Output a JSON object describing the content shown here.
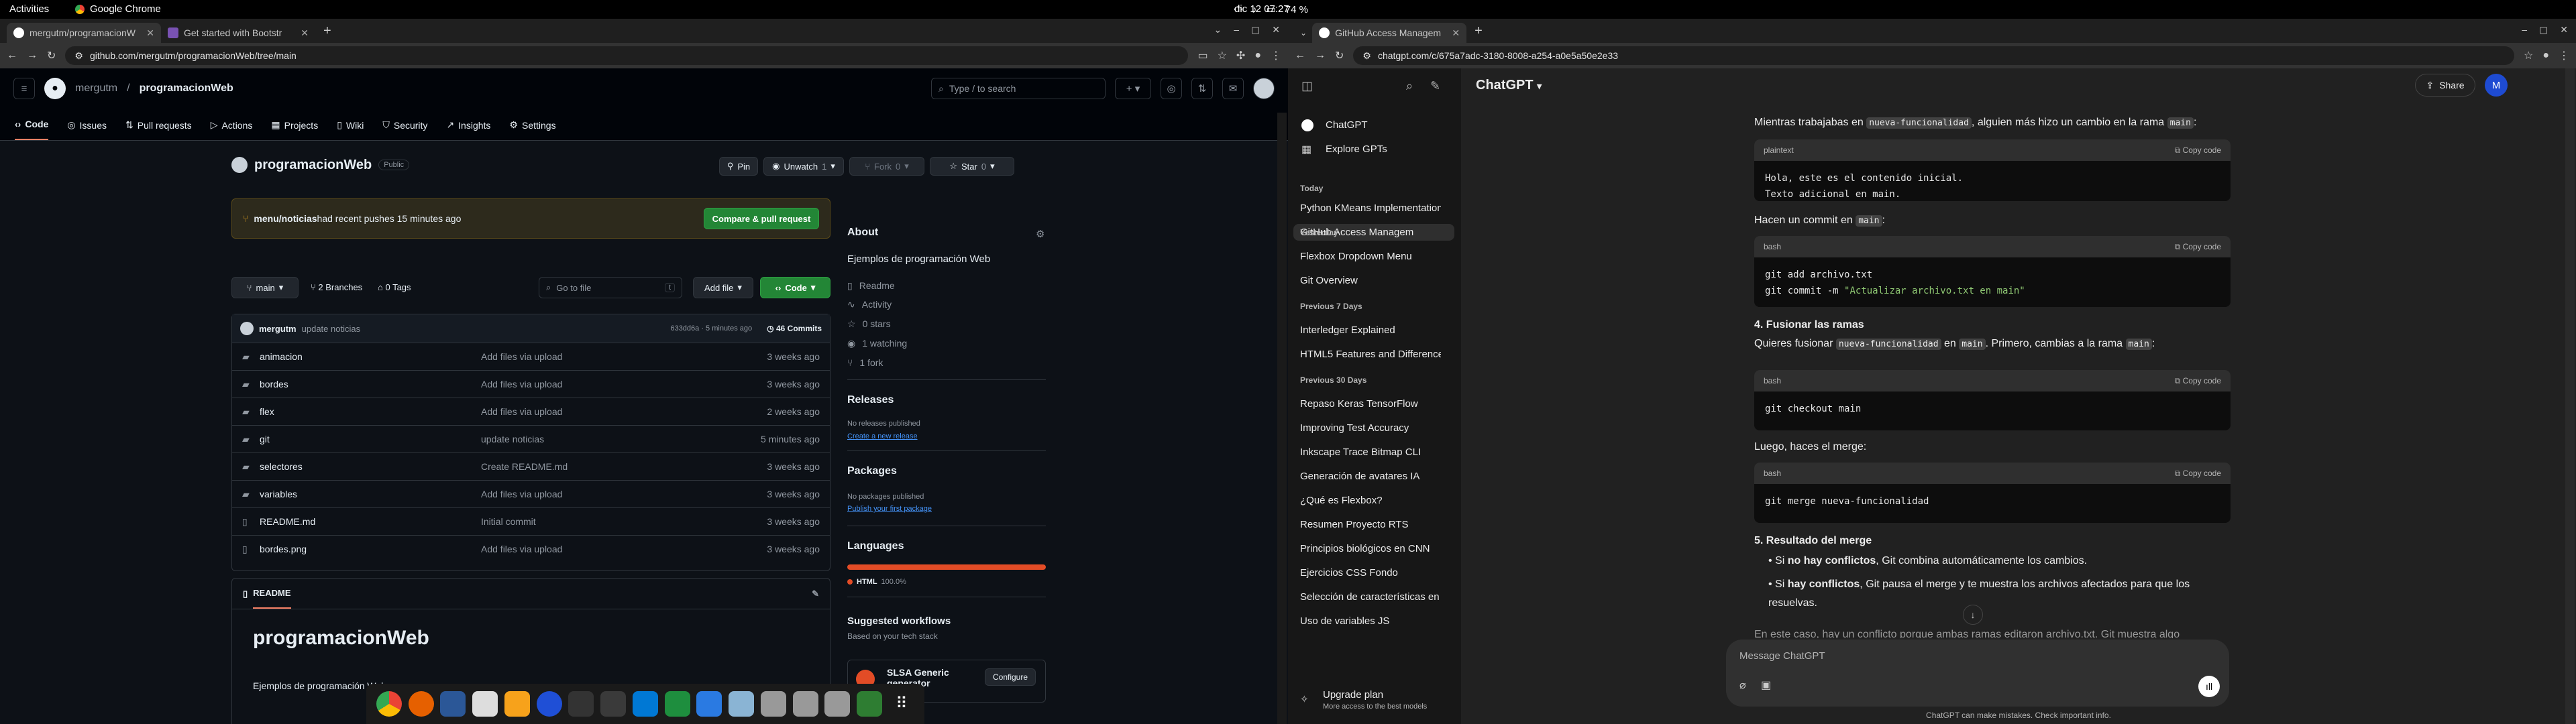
{
  "system": {
    "activities": "Activities",
    "app": "Google Chrome",
    "clock": "dic 12  07:27",
    "battery": "74 %"
  },
  "left": {
    "tabs": [
      {
        "label": "mergutm/programacionW"
      },
      {
        "label": "Get started with Bootstr"
      }
    ],
    "url": "github.com/mergutm/programacionWeb/tree/main",
    "gh": {
      "owner": "mergutm",
      "sep": "/",
      "repo": "programacionWeb",
      "search": "Type / to search",
      "nav": [
        "Code",
        "Issues",
        "Pull requests",
        "Actions",
        "Projects",
        "Wiki",
        "Security",
        "Insights",
        "Settings"
      ],
      "repo_title": "programacionWeb",
      "visibility": "Public",
      "pin": "Pin",
      "unwatch": "Unwatch",
      "unwatch_count": "1",
      "fork": "Fork",
      "fork_count": "0",
      "star": "Star",
      "star_count": "0",
      "banner_branch": "menu/noticias",
      "banner_text": " had recent pushes 15 minutes ago",
      "compare": "Compare & pull request",
      "branch": "main",
      "branches": "2 Branches",
      "tags": "0 Tags",
      "goto": "Go to file",
      "goto_key": "t",
      "addfile": "Add file",
      "codebtn": "Code",
      "commit_user": "mergutm",
      "commit_msg": "update noticias",
      "commit_meta": "633dd6a · 5 minutes ago",
      "commits": "46 Commits",
      "files": [
        {
          "icon": "folder-icon",
          "name": "animacion",
          "msg": "Add files via upload",
          "time": "3 weeks ago"
        },
        {
          "icon": "folder-icon",
          "name": "bordes",
          "msg": "Add files via upload",
          "time": "3 weeks ago"
        },
        {
          "icon": "folder-icon",
          "name": "flex",
          "msg": "Add files via upload",
          "time": "2 weeks ago"
        },
        {
          "icon": "folder-icon",
          "name": "git",
          "msg": "update noticias",
          "time": "5 minutes ago"
        },
        {
          "icon": "folder-icon",
          "name": "selectores",
          "msg": "Create README.md",
          "time": "3 weeks ago"
        },
        {
          "icon": "folder-icon",
          "name": "variables",
          "msg": "Add files via upload",
          "time": "3 weeks ago"
        },
        {
          "icon": "file-icon",
          "name": "README.md",
          "msg": "Initial commit",
          "time": "3 weeks ago"
        },
        {
          "icon": "file-icon",
          "name": "bordes.png",
          "msg": "Add files via upload",
          "time": "3 weeks ago"
        }
      ],
      "readme_tab": "README",
      "readme_h1": "programacionWeb",
      "readme_p": "Ejemplos de programación Web",
      "about": {
        "title": "About",
        "desc": "Ejemplos de programación Web",
        "readme": "Readme",
        "activity": "Activity",
        "stars": "0 stars",
        "watching": "1 watching",
        "fork": "1 fork"
      },
      "releases": {
        "title": "Releases",
        "none": "No releases published",
        "create": "Create a new release"
      },
      "packages": {
        "title": "Packages",
        "none": "No packages published",
        "publish": "Publish your first package"
      },
      "languages": {
        "title": "Languages",
        "html": "HTML",
        "pct": "100.0%",
        "color": "#e34c26"
      },
      "workflows": {
        "title": "Suggested workflows",
        "sub": "Based on your tech stack",
        "name": "SLSA Generic generator",
        "configure": "Configure"
      }
    }
  },
  "right": {
    "tab": "GitHub Access Managem",
    "url": "chatgpt.com/c/675a7adc-3180-8008-a254-a0e5a50e2e33",
    "sidebar": {
      "chatgpt": "ChatGPT",
      "explore": "Explore GPTs",
      "today": "Today",
      "today_items": [
        "Python KMeans Implementation",
        "GitHub Access Managem"
      ],
      "yesterday": "Yesterday",
      "yest_items": [
        "Flexbox Dropdown Menu",
        "Git Overview"
      ],
      "prev7": "Previous 7 Days",
      "prev7_items": [
        "Interledger Explained",
        "HTML5 Features and Difference"
      ],
      "prev30": "Previous 30 Days",
      "prev30_items": [
        "Repaso Keras TensorFlow",
        "Improving Test Accuracy",
        "Inkscape Trace Bitmap CLI",
        "Generación de avatares IA",
        "¿Qué es Flexbox?",
        "Resumen Proyecto RTS",
        "Principios biológicos en CNN",
        "Ejercicios CSS Fondo",
        "Selección de características en",
        "Uso de variables JS"
      ],
      "upgrade": "Upgrade plan",
      "upgrade_sub": "More access to the best models"
    },
    "header": {
      "title": "ChatGPT",
      "share": "Share",
      "avatar": "M"
    },
    "msg": {
      "p1a": "Mientras trabajabas en ",
      "p1b": "nueva-funcionalidad",
      "p1c": ", alguien más hizo un cambio en la rama ",
      "p1d": "main",
      "p1e": ":",
      "b1_lang": "plaintext",
      "b1": "Hola, este es el contenido inicial.\nTexto adicional en main.",
      "p2a": "Hacen un commit en ",
      "p2b": "main",
      "p2c": ":",
      "b2_lang": "bash",
      "b2_l1": "git add archivo.txt",
      "b2_l2a": "git commit -m ",
      "b2_l2b": "\"Actualizar archivo.txt en main\"",
      "h4": "4. Fusionar las ramas",
      "p3a": "Quieres fusionar ",
      "p3b": "nueva-funcionalidad",
      "p3c": " en ",
      "p3d": "main",
      "p3e": ". Primero, cambias a la rama ",
      "p3f": "main",
      "p3g": ":",
      "b3_lang": "bash",
      "b3": "git checkout main",
      "p4": "Luego, haces el merge:",
      "b4_lang": "bash",
      "b4": "git merge nueva-funcionalidad",
      "h5": "5. Resultado del merge",
      "li1a": "Si ",
      "li1b": "no hay conflictos",
      "li1c": ", Git combina automáticamente los cambios.",
      "li2a": "Si ",
      "li2b": "hay conflictos",
      "li2c": ", Git pausa el merge y te muestra los archivos afectados para que los resuelvas.",
      "p5": "En este caso, hay un conflicto porque ambas ramas editaron archivo.txt. Git muestra algo",
      "copy": "Copy code"
    },
    "composer": {
      "placeholder": "Message ChatGPT",
      "disclaimer": "ChatGPT can make mistakes. Check important info."
    }
  }
}
